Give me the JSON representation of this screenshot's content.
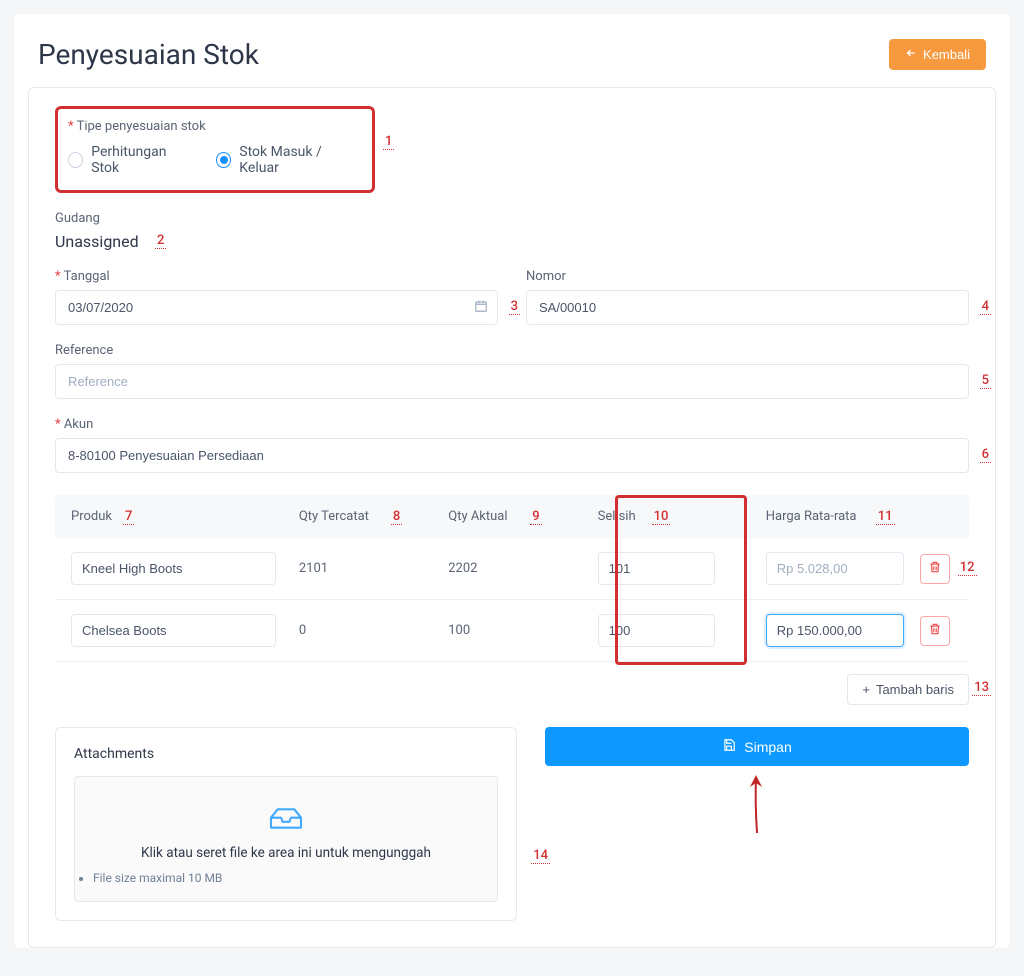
{
  "header": {
    "title": "Penyesuaian Stok",
    "back_label": "Kembali"
  },
  "type_section": {
    "label": "Tipe penyesuaian stok",
    "option1": "Perhitungan Stok",
    "option2": "Stok Masuk / Keluar"
  },
  "gudang": {
    "label": "Gudang",
    "value": "Unassigned"
  },
  "tanggal": {
    "label": "Tanggal",
    "value": "03/07/2020"
  },
  "nomor": {
    "label": "Nomor",
    "value": "SA/00010"
  },
  "reference": {
    "label": "Reference",
    "placeholder": "Reference"
  },
  "akun": {
    "label": "Akun",
    "value": "8-80100 Penyesuaian Persediaan"
  },
  "table": {
    "headers": {
      "produk": "Produk",
      "qty_tercatat": "Qty Tercatat",
      "qty_aktual": "Qty Aktual",
      "selisih": "Selisih",
      "harga": "Harga Rata-rata"
    },
    "rows": [
      {
        "produk": "Kneel High Boots",
        "qty_tercatat": "2101",
        "qty_aktual": "2202",
        "selisih": "101",
        "harga": "Rp 5.028,00"
      },
      {
        "produk": "Chelsea Boots",
        "qty_tercatat": "0",
        "qty_aktual": "100",
        "selisih": "100",
        "harga": "Rp 150.000,00"
      }
    ],
    "add_row": "Tambah baris"
  },
  "attachments": {
    "title": "Attachments",
    "drop_text": "Klik atau seret file ke area ini untuk mengunggah",
    "hint": "File size maximal 10 MB"
  },
  "save": "Simpan",
  "annotations": {
    "a1": "1",
    "a2": "2",
    "a3": "3",
    "a4": "4",
    "a5": "5",
    "a6": "6",
    "a7": "7",
    "a8": "8",
    "a9": "9",
    "a10": "10",
    "a11": "11",
    "a12": "12",
    "a13": "13",
    "a14": "14"
  }
}
